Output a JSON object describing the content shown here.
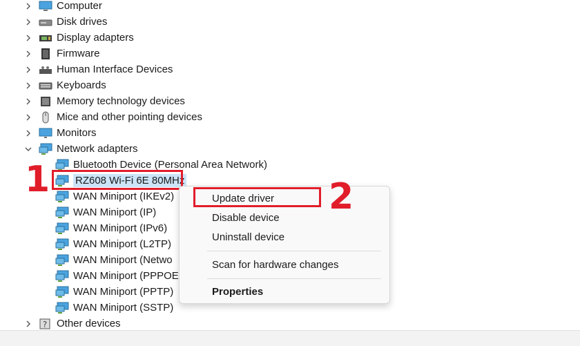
{
  "tree": {
    "categories": [
      {
        "label": "Computer",
        "icon": "computer-icon"
      },
      {
        "label": "Disk drives",
        "icon": "disk-drive-icon"
      },
      {
        "label": "Display adapters",
        "icon": "display-adapter-icon"
      },
      {
        "label": "Firmware",
        "icon": "firmware-icon"
      },
      {
        "label": "Human Interface Devices",
        "icon": "hid-icon"
      },
      {
        "label": "Keyboards",
        "icon": "keyboard-icon"
      },
      {
        "label": "Memory technology devices",
        "icon": "memory-icon"
      },
      {
        "label": "Mice and other pointing devices",
        "icon": "mouse-icon"
      },
      {
        "label": "Monitors",
        "icon": "monitor-icon"
      },
      {
        "label": "Network adapters",
        "icon": "network-adapter-icon"
      }
    ],
    "network_children": [
      {
        "label": "Bluetooth Device (Personal Area Network)"
      },
      {
        "label": "RZ608 Wi-Fi 6E 80MHz"
      },
      {
        "label": "WAN Miniport (IKEv2)"
      },
      {
        "label": "WAN Miniport (IP)"
      },
      {
        "label": "WAN Miniport (IPv6)"
      },
      {
        "label": "WAN Miniport (L2TP)"
      },
      {
        "label": "WAN Miniport (Netwo"
      },
      {
        "label": "WAN Miniport (PPPOE"
      },
      {
        "label": "WAN Miniport (PPTP)"
      },
      {
        "label": "WAN Miniport (SSTP)"
      }
    ],
    "last_category": {
      "label": "Other devices",
      "icon": "other-devices-icon"
    }
  },
  "context_menu": {
    "update_driver": "Update driver",
    "disable_device": "Disable device",
    "uninstall_device": "Uninstall device",
    "scan_hardware": "Scan for hardware changes",
    "properties": "Properties"
  },
  "callouts": {
    "one": "1",
    "two": "2"
  },
  "colors": {
    "highlight": "#e11d2a",
    "selection": "#cce4f7"
  }
}
